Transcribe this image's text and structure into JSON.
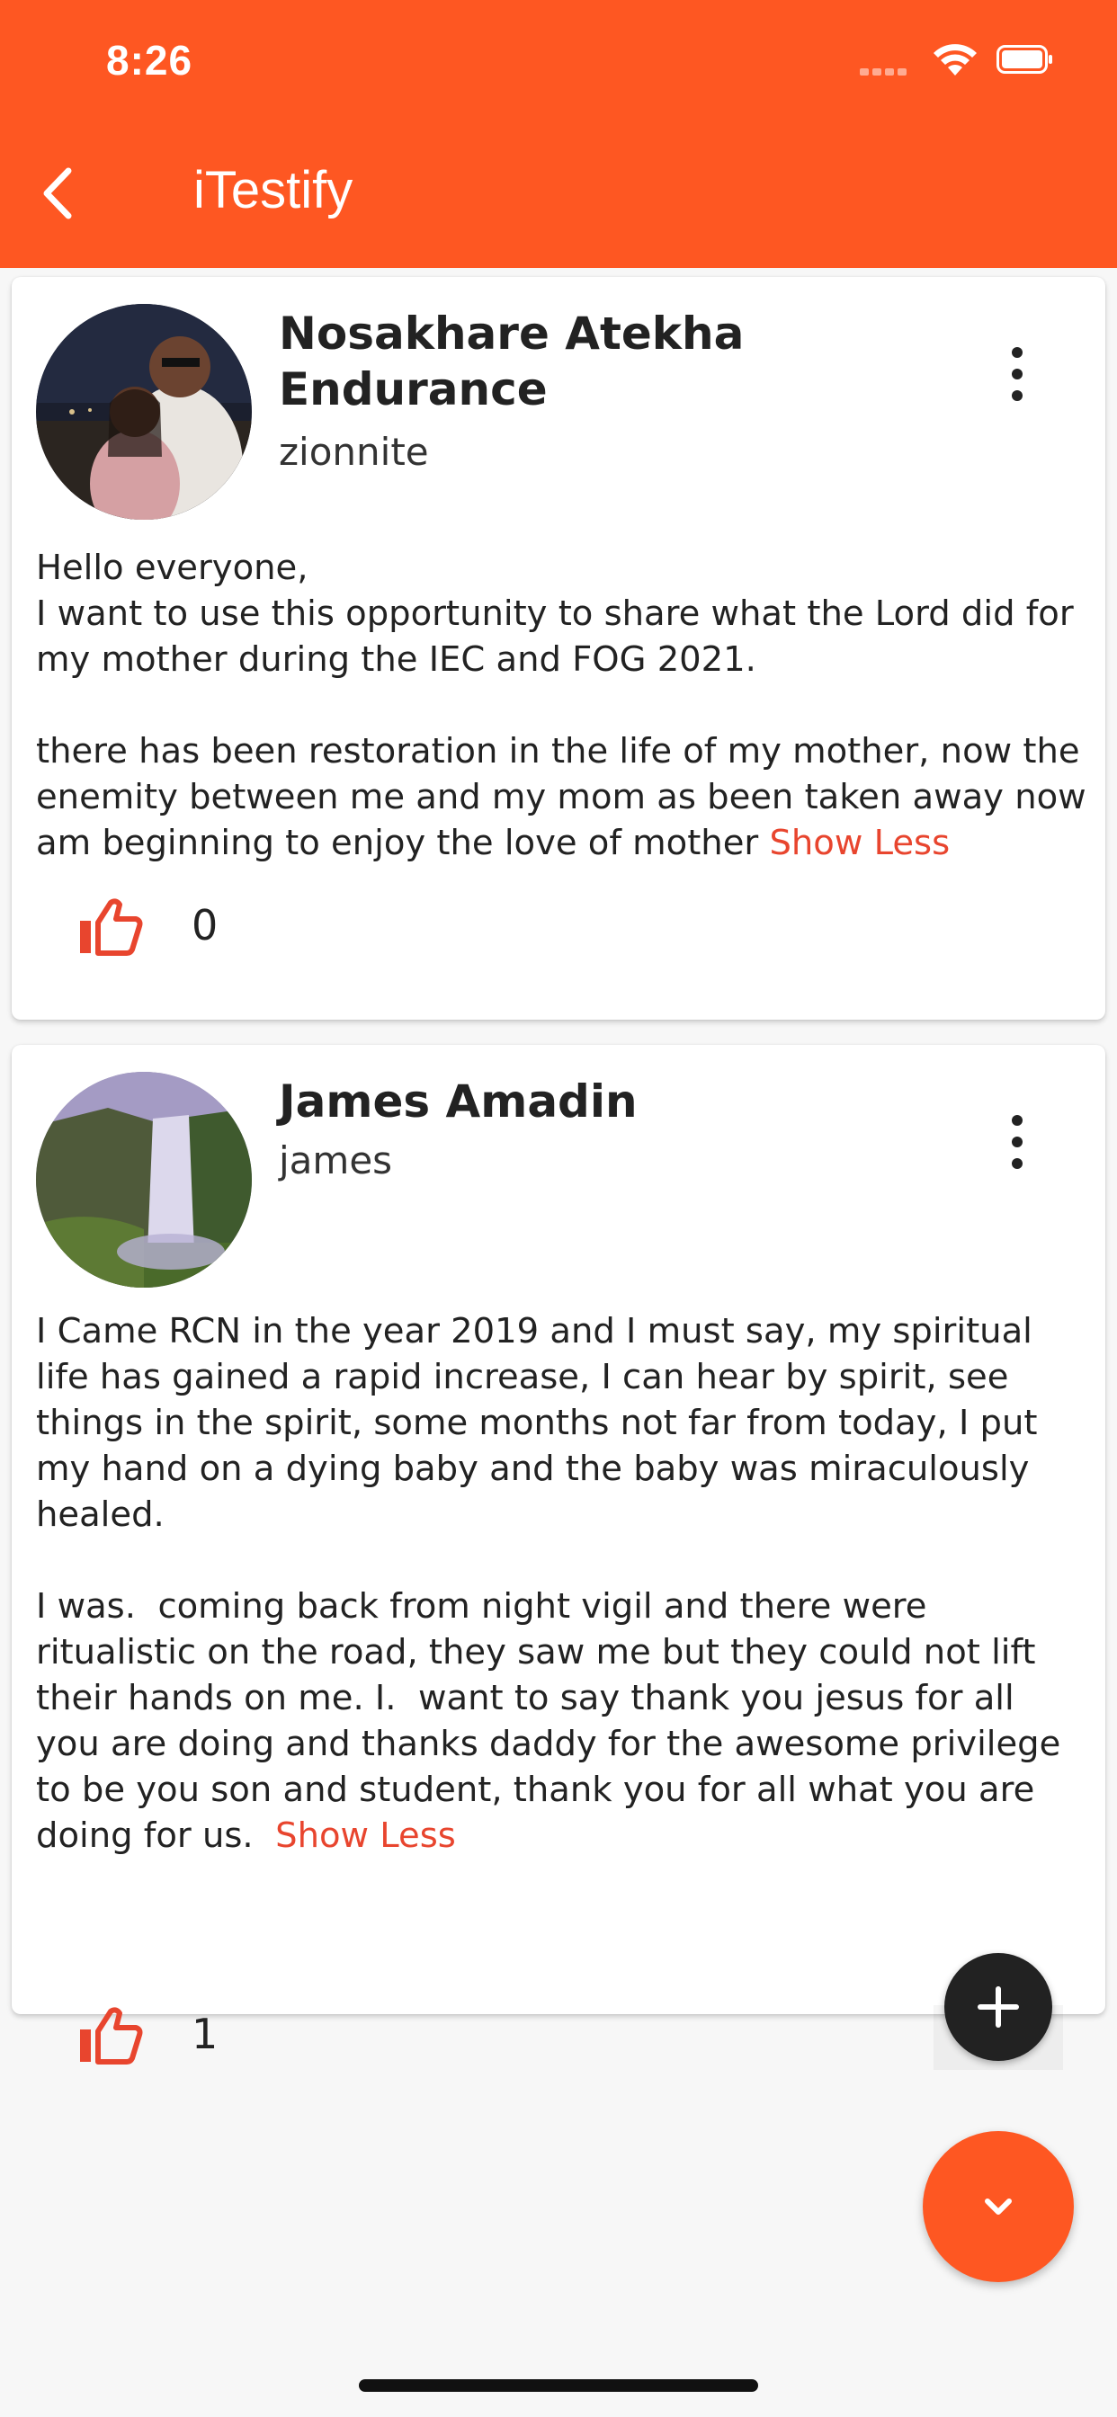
{
  "status_bar": {
    "time": "8:26"
  },
  "header": {
    "title": "iTestify",
    "back_icon": "chevron-left-icon"
  },
  "posts": [
    {
      "name": "Nosakhare Atekha Endurance",
      "username": "zionnite",
      "body": "Hello everyone,\nI want to use this opportunity to share what the Lord did for my mother during the IEC and FOG 2021.\n\nthere has been restoration in the life of my mother, now the enemity between me and my mom as been taken away now am beginning to enjoy the love of mother ",
      "show_less": "Show Less",
      "likes": "0"
    },
    {
      "name": "James Amadin",
      "username": "james",
      "body": "I Came RCN in the year 2019 and I must say, my spiritual life has gained a rapid increase, I can hear by spirit, see things in the spirit, some months not far from today, I put my hand on a dying baby and the baby was miraculously healed.\n\nI was.  coming back from night vigil and there were ritualistic on the road, they saw me but they could not lift their hands on me. I.  want to say thank you jesus for all you are doing and thanks daddy for the awesome privilege to be you son and student, thank you for all what you are doing for us.  ",
      "show_less": "Show Less",
      "likes": "1"
    }
  ],
  "colors": {
    "primary": "#fe5722",
    "accent_text": "#e8452e",
    "fab_dark": "#222222"
  },
  "icons": {
    "more": "more-vert-icon",
    "like": "thumb-up-icon",
    "add": "plus-icon",
    "scroll_down": "chevron-down-icon"
  }
}
